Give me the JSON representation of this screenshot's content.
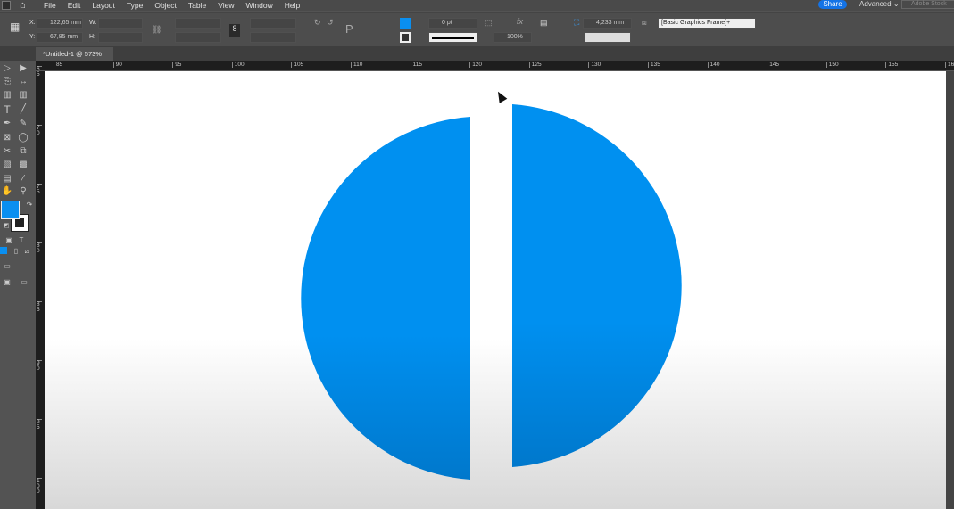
{
  "menubar": {
    "items": [
      "File",
      "Edit",
      "Layout",
      "Type",
      "Object",
      "Table",
      "View",
      "Window",
      "Help"
    ],
    "share": "Share",
    "workspace": "Advanced",
    "search_placeholder": "Adobe Stock"
  },
  "control": {
    "x_label": "X:",
    "x_value": "122,65 mm",
    "y_label": "Y:",
    "y_value": "67,85 mm",
    "w_label": "W:",
    "h_label": "H:",
    "stroke_weight": "0 pt",
    "opacity": "100%",
    "fitting_offset": "4,233 mm",
    "object_style": "[Basic Graphics Frame]+",
    "fill_color": "#0a8ff0"
  },
  "document_tab": {
    "title": "*Untitled-1 @ 573%",
    "close": "×"
  },
  "rulers": {
    "horizontal": [
      "85",
      "90",
      "95",
      "100",
      "105",
      "110",
      "115",
      "120",
      "125",
      "130",
      "135",
      "140",
      "145",
      "150",
      "155",
      "16"
    ],
    "vertical": [
      "65",
      "70",
      "75",
      "80",
      "85",
      "90",
      "95",
      "100"
    ]
  },
  "artwork": {
    "fill": "#0090f0",
    "shapes": [
      "left-half-circle",
      "right-half-circle"
    ]
  }
}
